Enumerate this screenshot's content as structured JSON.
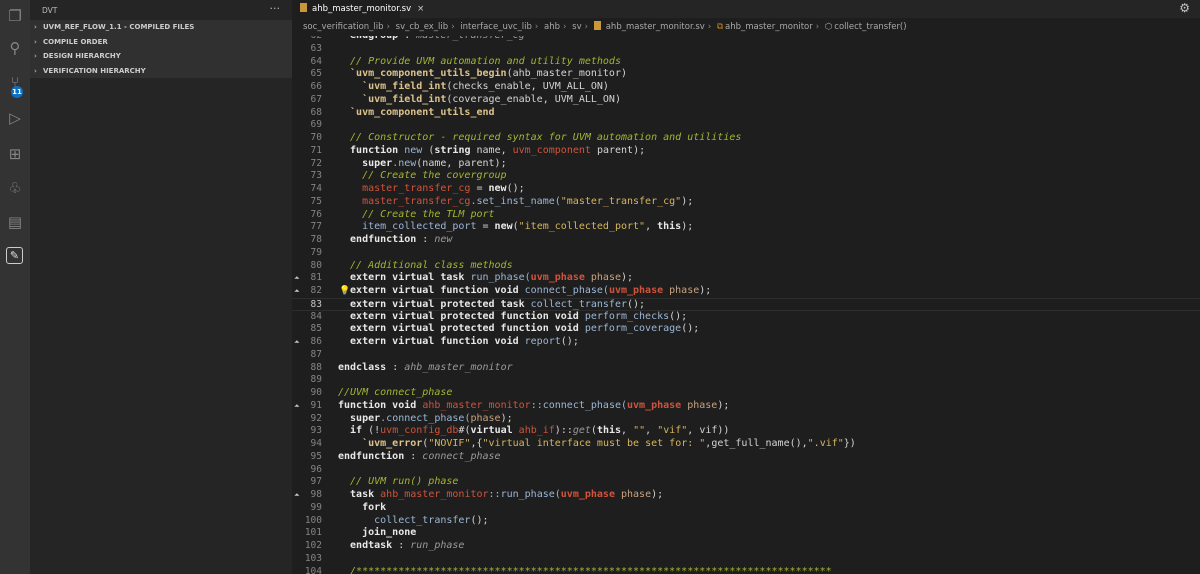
{
  "activity_bar": {
    "items": [
      "explorer",
      "search",
      "source-control",
      "run-debug",
      "extensions",
      "tree",
      "dvt-build",
      "dvt"
    ],
    "scm_badge": "11"
  },
  "sidebar": {
    "title": "DVT",
    "more": "···",
    "sections": [
      "UVM_REF_FLOW_1.1 - COMPILED FILES",
      "COMPILE ORDER",
      "DESIGN HIERARCHY",
      "VERIFICATION HIERARCHY"
    ]
  },
  "tab": {
    "label": "ahb_master_monitor.sv",
    "close": "×"
  },
  "breadcrumb": [
    "soc_verification_lib",
    "sv_cb_ex_lib",
    "interface_uvc_lib",
    "ahb",
    "sv",
    "ahb_master_monitor.sv",
    "ahb_master_monitor",
    "collect_transfer()"
  ],
  "colors": {
    "comment": "#a4b531",
    "identifier": "#d1533b",
    "string": "#d6b55c",
    "function": "#9cb6d4",
    "macro": "#dcc38c",
    "activity_bar": "#333333",
    "sidebar": "#252526",
    "editor": "#1e1e1e",
    "badge": "#0e70c0"
  },
  "code": [
    {
      "n": "62",
      "t": [
        [
          "  endgroup",
          "k"
        ],
        [
          " : ",
          "p"
        ],
        [
          "master_transfer_cg",
          "i"
        ]
      ]
    },
    {
      "n": "63",
      "t": []
    },
    {
      "n": "64",
      "t": [
        [
          "  // Provide UVM automation and utility methods",
          "c"
        ]
      ]
    },
    {
      "n": "65",
      "t": [
        [
          "  `uvm_component_utils_begin",
          "m"
        ],
        [
          "(ahb_master_monitor)",
          "p"
        ]
      ]
    },
    {
      "n": "66",
      "t": [
        [
          "    `uvm_field_int",
          "m"
        ],
        [
          "(checks_enable, UVM_ALL_ON)",
          "p"
        ]
      ]
    },
    {
      "n": "67",
      "t": [
        [
          "    `uvm_field_int",
          "m"
        ],
        [
          "(coverage_enable, UVM_ALL_ON)",
          "p"
        ]
      ]
    },
    {
      "n": "68",
      "t": [
        [
          "  `uvm_component_utils_end",
          "m"
        ]
      ]
    },
    {
      "n": "69",
      "t": []
    },
    {
      "n": "70",
      "t": [
        [
          "  // Constructor - required syntax for UVM automation and utilities",
          "c"
        ]
      ]
    },
    {
      "n": "71",
      "t": [
        [
          "  function",
          "k"
        ],
        [
          " new ",
          "f"
        ],
        [
          "(",
          "p"
        ],
        [
          "string",
          "k"
        ],
        [
          " name, ",
          "p"
        ],
        [
          "uvm_component",
          "r"
        ],
        [
          " parent);",
          "p"
        ]
      ]
    },
    {
      "n": "72",
      "t": [
        [
          "    super",
          "k"
        ],
        [
          ".new",
          "f"
        ],
        [
          "(name, parent);",
          "p"
        ]
      ]
    },
    {
      "n": "73",
      "t": [
        [
          "    // Create the covergroup",
          "c"
        ]
      ]
    },
    {
      "n": "74",
      "t": [
        [
          "    master_transfer_cg",
          "r"
        ],
        [
          " = ",
          "p"
        ],
        [
          "new",
          "k"
        ],
        [
          "();",
          "p"
        ]
      ]
    },
    {
      "n": "75",
      "t": [
        [
          "    master_transfer_cg",
          "r"
        ],
        [
          ".set_inst_name(",
          "f"
        ],
        [
          "\"master_transfer_cg\"",
          "s"
        ],
        [
          ");",
          "p"
        ]
      ]
    },
    {
      "n": "76",
      "t": [
        [
          "    // Create the TLM port",
          "c"
        ]
      ]
    },
    {
      "n": "77",
      "t": [
        [
          "    item_collected_port",
          "f"
        ],
        [
          " = ",
          "p"
        ],
        [
          "new",
          "k"
        ],
        [
          "(",
          "p"
        ],
        [
          "\"item_collected_port\"",
          "s"
        ],
        [
          ", ",
          "p"
        ],
        [
          "this",
          "k"
        ],
        [
          ");",
          "p"
        ]
      ]
    },
    {
      "n": "78",
      "t": [
        [
          "  endfunction",
          "k"
        ],
        [
          " : ",
          "p"
        ],
        [
          "new",
          "i"
        ]
      ]
    },
    {
      "n": "79",
      "t": []
    },
    {
      "n": "80",
      "t": [
        [
          "  // Additional class methods",
          "c"
        ]
      ]
    },
    {
      "n": "81",
      "fold": true,
      "t": [
        [
          "  extern virtual task",
          "k"
        ],
        [
          " run_phase(",
          "f"
        ],
        [
          "uvm_phase",
          "rb"
        ],
        [
          " phase",
          "a"
        ],
        [
          ");",
          "p"
        ]
      ]
    },
    {
      "n": "82",
      "fold": true,
      "bulb": true,
      "t": [
        [
          "  extern virtual function void",
          "k"
        ],
        [
          " connect_phase(",
          "f"
        ],
        [
          "uvm_phase",
          "rb"
        ],
        [
          " phase",
          "a"
        ],
        [
          ");",
          "p"
        ]
      ]
    },
    {
      "n": "83",
      "cur": true,
      "t": [
        [
          "  extern virtual protected task",
          "k"
        ],
        [
          " collect_transfer",
          "f"
        ],
        [
          "();",
          "p"
        ]
      ]
    },
    {
      "n": "84",
      "t": [
        [
          "  extern virtual protected function void",
          "k"
        ],
        [
          " perform_checks",
          "f"
        ],
        [
          "();",
          "p"
        ]
      ]
    },
    {
      "n": "85",
      "t": [
        [
          "  extern virtual protected function void",
          "k"
        ],
        [
          " perform_coverage",
          "f"
        ],
        [
          "();",
          "p"
        ]
      ]
    },
    {
      "n": "86",
      "fold": true,
      "t": [
        [
          "  extern virtual function void",
          "k"
        ],
        [
          " report",
          "f"
        ],
        [
          "();",
          "p"
        ]
      ]
    },
    {
      "n": "87",
      "t": []
    },
    {
      "n": "88",
      "t": [
        [
          "endclass",
          "k"
        ],
        [
          " : ",
          "p"
        ],
        [
          "ahb_master_monitor",
          "i"
        ]
      ]
    },
    {
      "n": "89",
      "t": []
    },
    {
      "n": "90",
      "t": [
        [
          "//UVM connect_phase",
          "c"
        ]
      ]
    },
    {
      "n": "91",
      "fold": true,
      "t": [
        [
          "function void",
          "k"
        ],
        [
          " ",
          "p"
        ],
        [
          "ahb_master_monitor",
          "r"
        ],
        [
          "::connect_phase(",
          "f"
        ],
        [
          "uvm_phase",
          "rb"
        ],
        [
          " phase",
          "a"
        ],
        [
          ");",
          "p"
        ]
      ]
    },
    {
      "n": "92",
      "t": [
        [
          "  super",
          "k"
        ],
        [
          ".connect_phase(",
          "f"
        ],
        [
          "phase",
          "a"
        ],
        [
          ");",
          "p"
        ]
      ]
    },
    {
      "n": "93",
      "t": [
        [
          "  if",
          "k"
        ],
        [
          " (!",
          "p"
        ],
        [
          "uvm_config_db",
          "r"
        ],
        [
          "#(",
          "p"
        ],
        [
          "virtual",
          "k"
        ],
        [
          " ",
          "p"
        ],
        [
          "ahb_if",
          "r"
        ],
        [
          ")::",
          "p"
        ],
        [
          "get",
          "i"
        ],
        [
          "(",
          "p"
        ],
        [
          "this",
          "k"
        ],
        [
          ", ",
          "p"
        ],
        [
          "\"\"",
          "s"
        ],
        [
          ", ",
          "p"
        ],
        [
          "\"vif\"",
          "s"
        ],
        [
          ", vif))",
          "p"
        ]
      ]
    },
    {
      "n": "94",
      "t": [
        [
          "    `uvm_error",
          "m"
        ],
        [
          "(",
          "p"
        ],
        [
          "\"NOVIF\"",
          "s"
        ],
        [
          ",{",
          "p"
        ],
        [
          "\"virtual interface must be set for: \"",
          "s"
        ],
        [
          ",get_full_name(),",
          "p"
        ],
        [
          "\".vif\"",
          "s"
        ],
        [
          "})",
          "p"
        ]
      ]
    },
    {
      "n": "95",
      "t": [
        [
          "endfunction",
          "k"
        ],
        [
          " : ",
          "p"
        ],
        [
          "connect_phase",
          "i"
        ]
      ]
    },
    {
      "n": "96",
      "t": []
    },
    {
      "n": "97",
      "t": [
        [
          "  // UVM run() phase",
          "c"
        ]
      ]
    },
    {
      "n": "98",
      "fold": true,
      "t": [
        [
          "  task",
          "k"
        ],
        [
          " ",
          "p"
        ],
        [
          "ahb_master_monitor",
          "r"
        ],
        [
          "::run_phase(",
          "f"
        ],
        [
          "uvm_phase",
          "rb"
        ],
        [
          " phase",
          "a"
        ],
        [
          ");",
          "p"
        ]
      ]
    },
    {
      "n": "99",
      "t": [
        [
          "    fork",
          "k"
        ]
      ]
    },
    {
      "n": "100",
      "t": [
        [
          "      collect_transfer",
          "f"
        ],
        [
          "();",
          "p"
        ]
      ]
    },
    {
      "n": "101",
      "t": [
        [
          "    join_none",
          "k"
        ]
      ]
    },
    {
      "n": "102",
      "t": [
        [
          "  endtask",
          "k"
        ],
        [
          " : ",
          "p"
        ],
        [
          "run_phase",
          "i"
        ]
      ]
    },
    {
      "n": "103",
      "t": []
    },
    {
      "n": "104",
      "t": [
        [
          "  /*******************************************************************************",
          "c"
        ]
      ]
    }
  ]
}
